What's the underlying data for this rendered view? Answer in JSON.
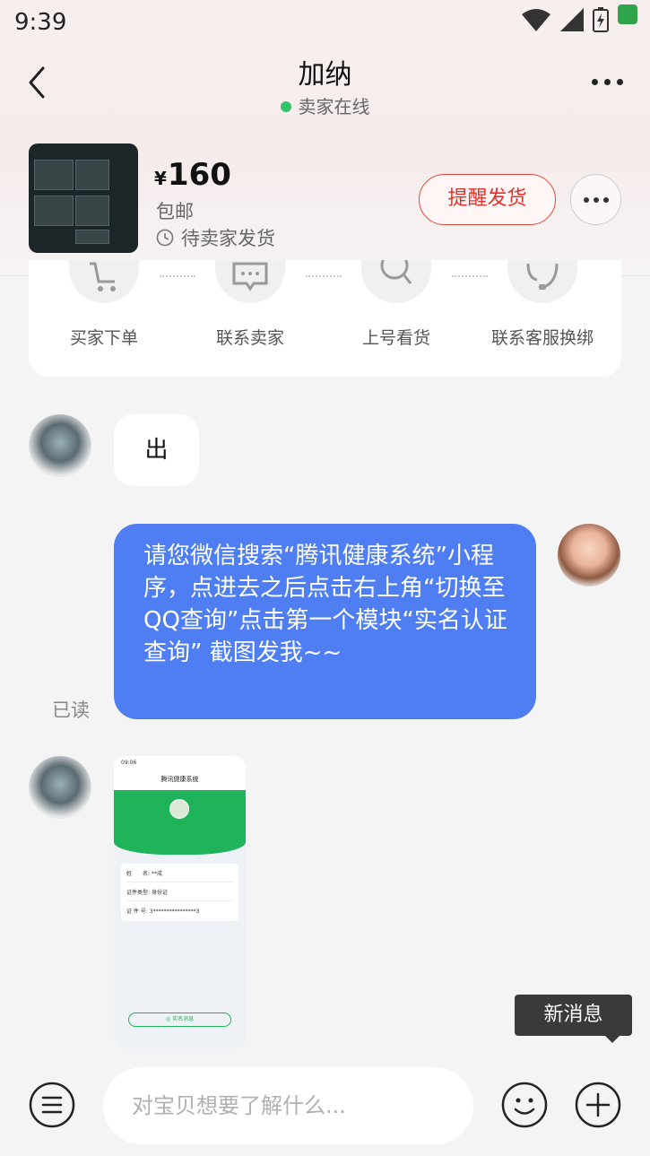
{
  "status_bar": {
    "time": "9:39"
  },
  "header": {
    "title": "加纳",
    "seller_status": "卖家在线"
  },
  "product": {
    "currency": "¥",
    "price": "160",
    "shipping": "包邮",
    "order_status": "待卖家发货",
    "remind_button": "提醒发货"
  },
  "actions": [
    {
      "label": "买家下单",
      "icon": "cart-icon"
    },
    {
      "label": "联系卖家",
      "icon": "chat-icon"
    },
    {
      "label": "上号看货",
      "icon": "search-icon"
    },
    {
      "label": "联系客服换绑",
      "icon": "headset-icon"
    }
  ],
  "messages": {
    "buyer_text": "出",
    "seller_text": "请您微信搜索“腾讯健康系统”小程序，点进去之后点击右上角“切换至QQ查询”点击第一个模块“实名认证查询” 截图发我~~",
    "read_status": "已读"
  },
  "screenshot_message": {
    "time": "09:06",
    "title": "腾讯健康系统",
    "rows": [
      {
        "label": "姓　　名:",
        "value": "**成"
      },
      {
        "label": "证件类型:",
        "value": "身份证"
      },
      {
        "label": "证 件 号:",
        "value": "3****************3"
      }
    ],
    "button": "◎ 实名消息"
  },
  "new_message_tip": "新消息",
  "input": {
    "placeholder": "对宝贝想要了解什么..."
  },
  "colors": {
    "accent_blue": "#4e7ef2",
    "remind_red": "#e0322a",
    "online_green": "#33c46a"
  }
}
